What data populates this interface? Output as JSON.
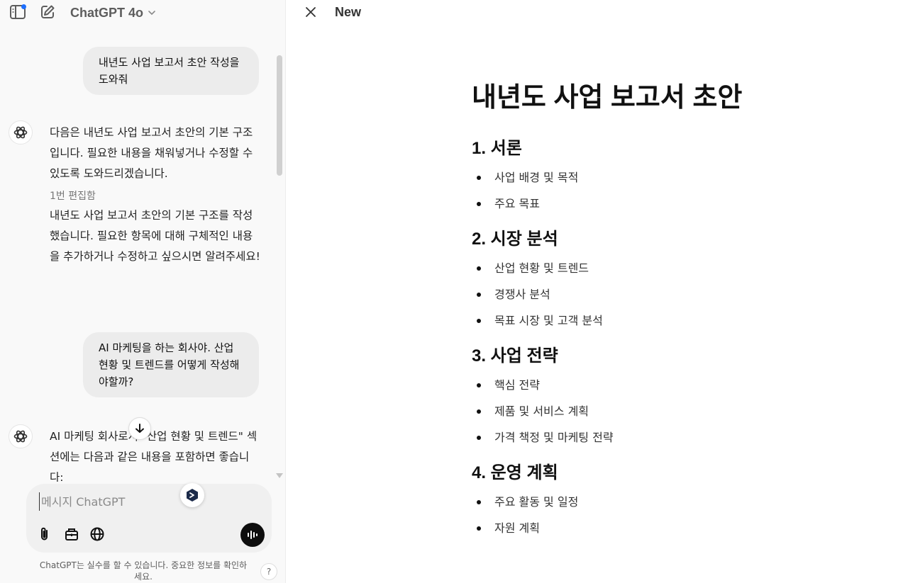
{
  "chat": {
    "model_name": "ChatGPT 4o",
    "messages": [
      {
        "role": "user",
        "text": "내년도 사업 보고서 초안 작성을 도와줘"
      },
      {
        "role": "assistant",
        "text": "다음은 내년도 사업 보고서 초안의 기본 구조입니다. 필요한 내용을 채워넣거나 수정할 수 있도록 도와드리겠습니다.",
        "edit_label": "1번 편집함",
        "followup": "내년도 사업 보고서 초안의 기본 구조를 작성했습니다. 필요한 항목에 대해 구체적인 내용을 추가하거나 수정하고 싶으시면 알려주세요!"
      },
      {
        "role": "user",
        "text": "AI 마케팅을 하는 회사야. 산업 현황 및 트렌드를 어떻게 작성해야할까?"
      },
      {
        "role": "assistant",
        "text": "AI 마케팅 회사로서 \"산업 현황 및 트렌드\" 섹션에는 다음과 같은 내용을 포함하면 좋습니다:"
      }
    ],
    "composer": {
      "placeholder": "메시지 ChatGPT"
    },
    "disclaimer": "ChatGPT는 실수를 할 수 있습니다. 중요한 정보를 확인하세요.",
    "help_label": "?"
  },
  "canvas": {
    "doc_name": "New",
    "title": "내년도 사업 보고서 초안",
    "sections": [
      {
        "heading": "1. 서론",
        "items": [
          "사업 배경 및 목적",
          "주요 목표"
        ]
      },
      {
        "heading": "2. 시장 분석",
        "items": [
          "산업 현황 및 트렌드",
          "경쟁사 분석",
          "목표 시장 및 고객 분석"
        ]
      },
      {
        "heading": "3. 사업 전략",
        "items": [
          "핵심 전략",
          "제품 및 서비스 계획",
          "가격 책정 및 마케팅 전략"
        ]
      },
      {
        "heading": "4. 운영 계획",
        "items": [
          "주요 활동 및 일정",
          "자원 계획"
        ]
      }
    ]
  },
  "icons": {
    "sidebar": "sidebar-toggle-icon",
    "new_chat": "pencil-square-icon",
    "model_dropdown": "chevron-down-icon",
    "assistant_avatar": "openai-logo-icon",
    "scroll_down": "arrow-down-icon",
    "attach": "paperclip-icon",
    "tools": "toolbox-icon",
    "web": "globe-icon",
    "voice": "voice-waveform-icon",
    "close": "close-icon"
  },
  "colors": {
    "accent_dot": "#1e6fff",
    "bubble": "#ececec",
    "panel": "#f9f9f9",
    "voice_button": "#0d0d0d"
  }
}
